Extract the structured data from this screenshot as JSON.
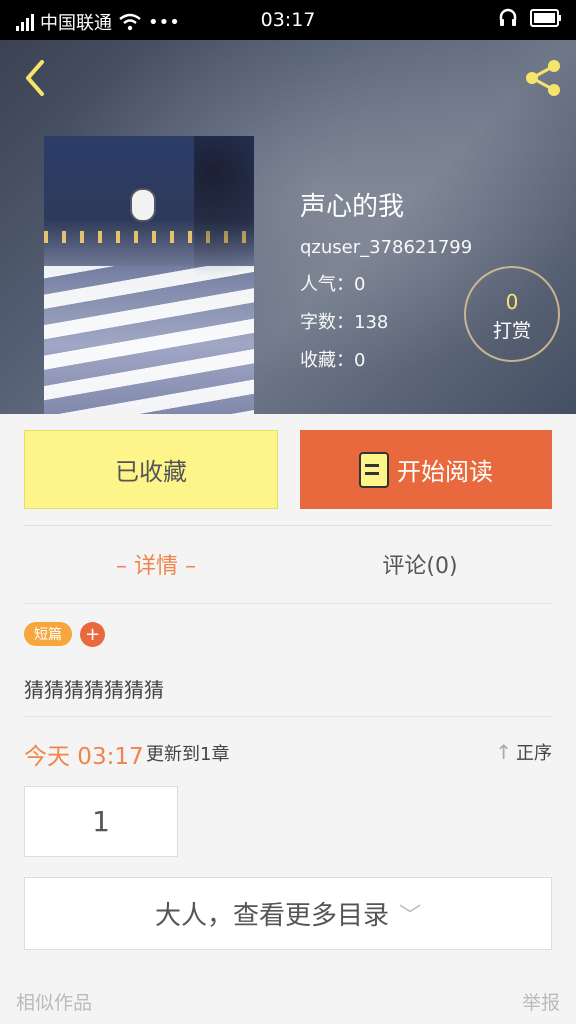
{
  "status_bar": {
    "carrier": "中国联通",
    "more": "•••",
    "time": "03:17"
  },
  "book": {
    "title": "声心的我",
    "author": "qzuser_378621799",
    "popularity": "人气：0",
    "word_count": "字数：138",
    "favorites": "收藏：0"
  },
  "reward": {
    "count": "0",
    "label": "打赏"
  },
  "actions": {
    "collected_label": "已收藏",
    "read_label": "开始阅读"
  },
  "tabs": {
    "detail": "– 详情 –",
    "comments": "评论(0)"
  },
  "tags": {
    "type": "短篇",
    "add": "+"
  },
  "description": "猜猜猜猜猜猜猜",
  "update": {
    "time": "今天 03:17",
    "text": "更新到1章",
    "sort": "正序"
  },
  "chapters": [
    "1"
  ],
  "more_catalog": "大人，查看更多目录",
  "footer": {
    "similar": "相似作品",
    "report": "举报"
  },
  "colors": {
    "accent": "#e8693d",
    "collected": "#fdf58a",
    "highlight": "#f0844a"
  }
}
